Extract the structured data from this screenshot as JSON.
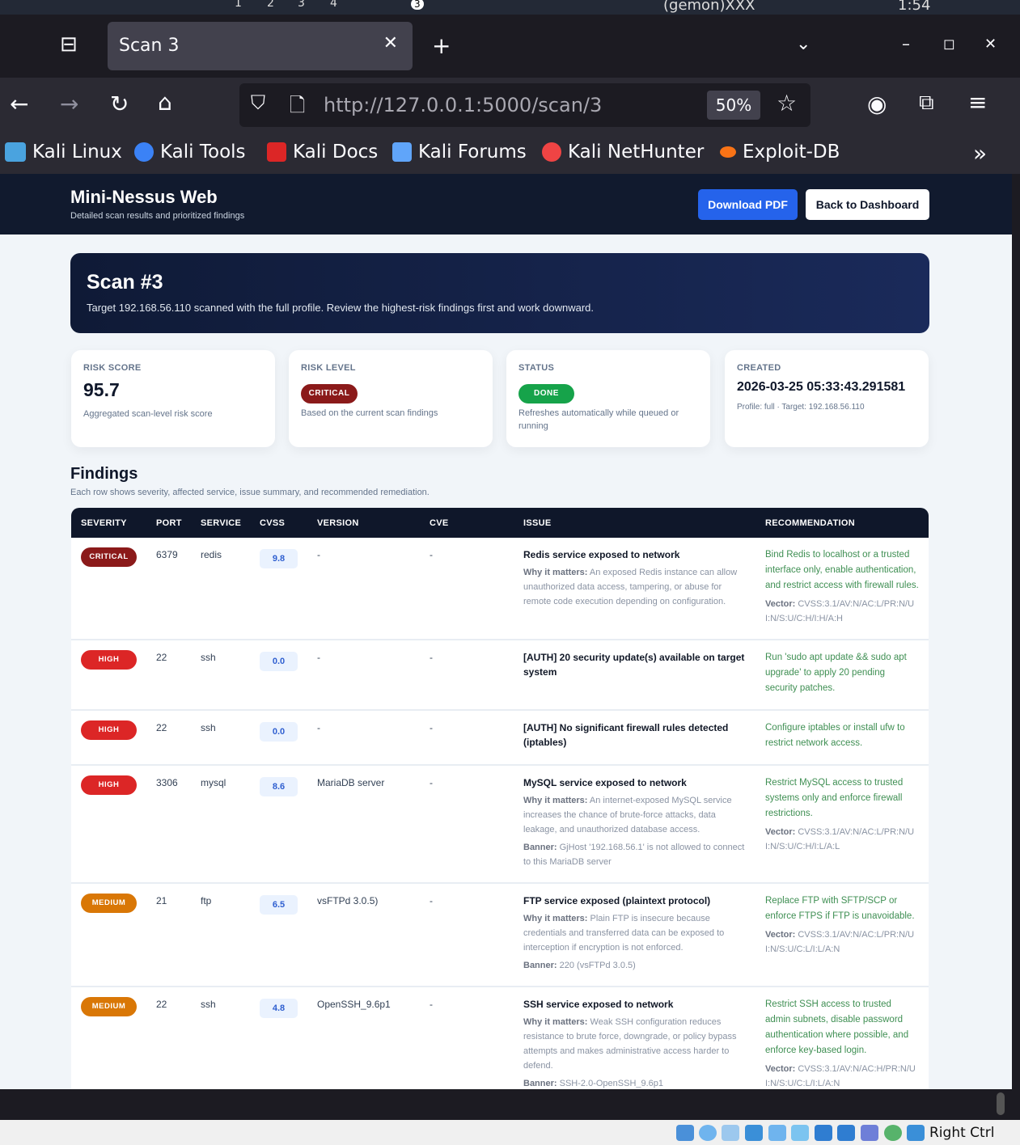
{
  "os_taskbar": {
    "workspaces": [
      "1",
      "2",
      "3",
      "4"
    ],
    "notification_count": "3",
    "user": "(gemon)XXX",
    "clock": "1:54"
  },
  "browser": {
    "tab_title": "Scan 3",
    "url_host": "http://127.0.0.1",
    "url_rest": ":5000/scan/3",
    "zoom": "50%",
    "bookmarks": [
      {
        "label": "Kali Linux",
        "color": "#4aa3df"
      },
      {
        "label": "Kali Tools",
        "color": "#3b82f6"
      },
      {
        "label": "Kali Docs",
        "color": "#dc2626"
      },
      {
        "label": "Kali Forums",
        "color": "#60a5fa"
      },
      {
        "label": "Kali NetHunter",
        "color": "#ef4444"
      },
      {
        "label": "Exploit-DB",
        "color": "#f97316"
      }
    ]
  },
  "app": {
    "title": "Mini-Nessus Web",
    "subtitle": "Detailed scan results and prioritized findings",
    "download_pdf": "Download PDF",
    "back_dashboard": "Back to Dashboard"
  },
  "hero": {
    "title": "Scan #3",
    "description": "Target 192.168.56.110 scanned with the full profile. Review the highest-risk findings first and work downward."
  },
  "cards": {
    "risk_score": {
      "label": "RISK SCORE",
      "value": "95.7",
      "note": "Aggregated scan-level risk score"
    },
    "risk_level": {
      "label": "RISK LEVEL",
      "value": "CRITICAL",
      "note": "Based on the current scan findings"
    },
    "status": {
      "label": "STATUS",
      "value": "DONE",
      "note": "Refreshes automatically while queued or running"
    },
    "created": {
      "label": "CREATED",
      "value": "2026-03-25 05:33:43.291581",
      "note": "Profile: full · Target: 192.168.56.110"
    }
  },
  "findings": {
    "title": "Findings",
    "subtitle": "Each row shows severity, affected service, issue summary, and recommended remediation.",
    "columns": [
      "SEVERITY",
      "PORT",
      "SERVICE",
      "CVSS",
      "VERSION",
      "CVE",
      "ISSUE",
      "RECOMMENDATION"
    ],
    "why_label": "Why it matters:",
    "banner_label": "Banner:",
    "vector_label": "Vector:",
    "severity_colors": {
      "CRITICAL": "#8b1a1a",
      "HIGH": "#dc2626",
      "MEDIUM": "#d97706"
    },
    "rows": [
      {
        "severity": "CRITICAL",
        "port": "6379",
        "service": "redis",
        "cvss": "9.8",
        "version": "-",
        "cve": "-",
        "issue": "Redis service exposed to network",
        "why": "An exposed Redis instance can allow unauthorized data access, tampering, or abuse for remote code execution depending on configuration.",
        "banner": "",
        "recommendation": "Bind Redis to localhost or a trusted interface only, enable authentication, and restrict access with firewall rules.",
        "vector": "CVSS:3.1/AV:N/AC:L/PR:N/UI:N/S:U/C:H/I:H/A:H"
      },
      {
        "severity": "HIGH",
        "port": "22",
        "service": "ssh",
        "cvss": "0.0",
        "version": "-",
        "cve": "-",
        "issue": "[AUTH] 20 security update(s) available on target system",
        "why": "",
        "banner": "",
        "recommendation": "Run 'sudo apt update && sudo apt upgrade' to apply 20 pending security patches.",
        "vector": ""
      },
      {
        "severity": "HIGH",
        "port": "22",
        "service": "ssh",
        "cvss": "0.0",
        "version": "-",
        "cve": "-",
        "issue": "[AUTH] No significant firewall rules detected (iptables)",
        "why": "",
        "banner": "",
        "recommendation": "Configure iptables or install ufw to restrict network access.",
        "vector": ""
      },
      {
        "severity": "HIGH",
        "port": "3306",
        "service": "mysql",
        "cvss": "8.6",
        "version": "MariaDB server",
        "cve": "-",
        "issue": "MySQL service exposed to network",
        "why": "An internet-exposed MySQL service increases the chance of brute-force attacks, data leakage, and unauthorized database access.",
        "banner": "GjHost '192.168.56.1' is not allowed to connect to this MariaDB server",
        "recommendation": "Restrict MySQL access to trusted systems only and enforce firewall restrictions.",
        "vector": "CVSS:3.1/AV:N/AC:L/PR:N/UI:N/S:U/C:H/I:L/A:L"
      },
      {
        "severity": "MEDIUM",
        "port": "21",
        "service": "ftp",
        "cvss": "6.5",
        "version": "vsFTPd 3.0.5)",
        "cve": "-",
        "issue": "FTP service exposed (plaintext protocol)",
        "why": "Plain FTP is insecure because credentials and transferred data can be exposed to interception if encryption is not enforced.",
        "banner": "220 (vsFTPd 3.0.5)",
        "recommendation": "Replace FTP with SFTP/SCP or enforce FTPS if FTP is unavoidable.",
        "vector": "CVSS:3.1/AV:N/AC:L/PR:N/UI:N/S:U/C:L/I:L/A:N"
      },
      {
        "severity": "MEDIUM",
        "port": "22",
        "service": "ssh",
        "cvss": "4.8",
        "version": "OpenSSH_9.6p1",
        "cve": "-",
        "issue": "SSH service exposed to network",
        "why": "Weak SSH configuration reduces resistance to brute force, downgrade, or policy bypass attempts and makes administrative access harder to defend.",
        "banner": "SSH-2.0-OpenSSH_9.6p1",
        "recommendation": "Restrict SSH access to trusted admin subnets, disable password authentication where possible, and enforce key-based login.",
        "vector": "CVSS:3.1/AV:N/AC:H/PR:N/UI:N/S:U/C:L/I:L/A:N"
      }
    ]
  },
  "vm_statusbar": {
    "host_key": "Right Ctrl"
  }
}
